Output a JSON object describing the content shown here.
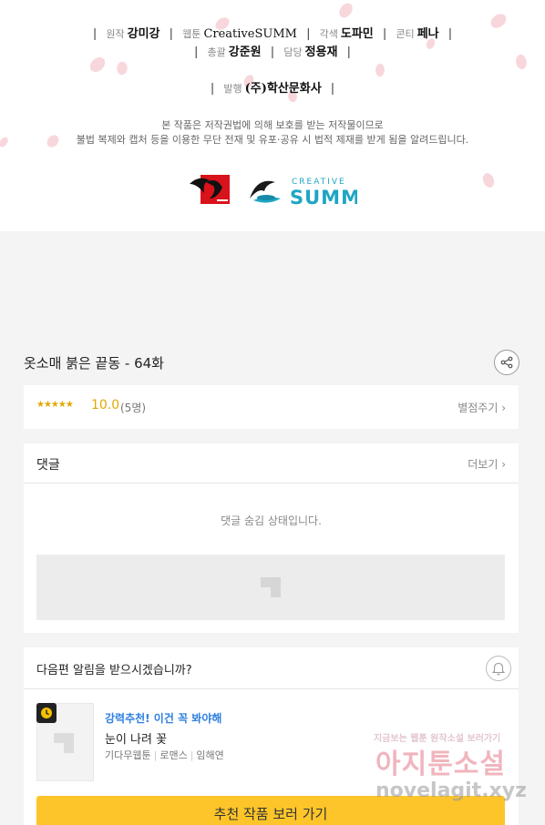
{
  "credits": {
    "row1": [
      {
        "role": "원작",
        "name": "강미강"
      },
      {
        "role": "웹툰",
        "name": "CreativeSUMM"
      },
      {
        "role": "각색",
        "name": "도파민"
      },
      {
        "role": "콘티",
        "name": "페나"
      }
    ],
    "row2": [
      {
        "role": "총괄",
        "name": "강준원"
      },
      {
        "role": "담당",
        "name": "정용재"
      }
    ],
    "row3": [
      {
        "role": "발행",
        "name": "(주)학산문화사"
      }
    ],
    "separator": "|",
    "notice_line1": "본 작품은 저작권법에 의해 보호를 받는 저작물이므로",
    "notice_line2": "불법 복제와 캡처 등을 이용한 무단 전재 및 유포·공유 시 법적 제재를 받게 됨을 알려드립니다.",
    "logo_text": "CREATIVE SUMM",
    "logo_text_top": "CREATIVE",
    "logo_text_bottom": "SUMM"
  },
  "episode": {
    "title": "옷소매 붉은 끝동 - 64화",
    "share_icon": "share-icon"
  },
  "rating": {
    "stars": "★★★★★",
    "score": "10.0",
    "count": "(5명)",
    "rate_link": "별점주기 ›"
  },
  "comments": {
    "title": "댓글",
    "more": "더보기 ›",
    "hidden_message": "댓글 숨김 상태입니다."
  },
  "notify": {
    "question": "다음편 알림을 받으시겠습니까?",
    "bell_icon": "bell-icon"
  },
  "recommend": {
    "label": "강력추천! 이건 꼭 봐야해",
    "title": "눈이 나려 꽃",
    "meta": [
      "기다무웹툰",
      "로맨스",
      "임해연"
    ],
    "button": "추천 작품 보러 가기"
  },
  "watermark": {
    "top": "지금보는 웹툰 원작소설 보러가기",
    "middle": "아지툰소설",
    "bottom": "novelagit.xyz"
  },
  "colors": {
    "accent_yellow": "#fdc52a",
    "star": "#e0a800",
    "link_blue": "#2f7fe0",
    "petal": "#f6cdd3"
  }
}
